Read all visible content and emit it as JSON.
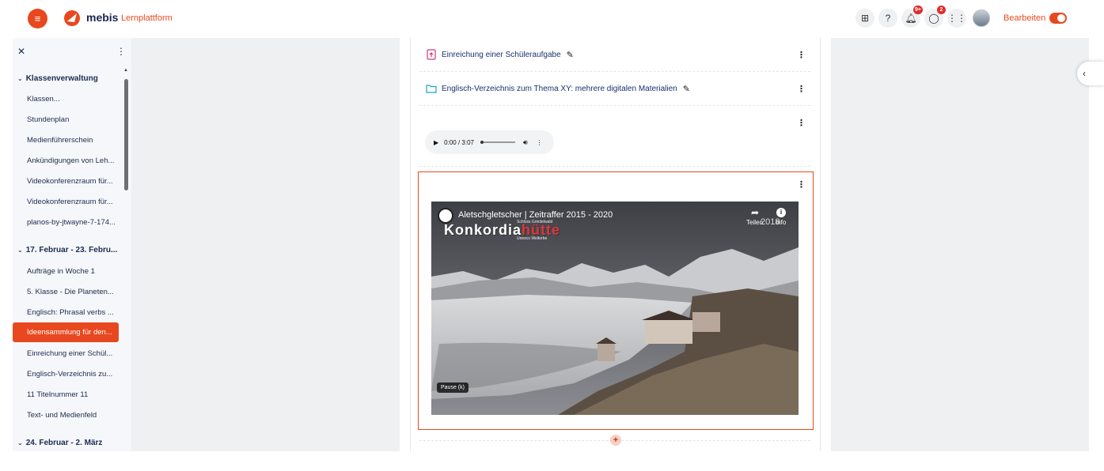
{
  "header": {
    "brand": "mebis",
    "brand_sub": "Lernplattform",
    "icons": [
      "qr-code-icon",
      "help-icon",
      "bell-icon",
      "chat-icon",
      "grid-icon"
    ],
    "notifications_badge": "9+",
    "messages_badge": "2",
    "edit_label": "Bearbeiten",
    "edit_mode": true,
    "accent_color": "#e8481f"
  },
  "drawer": {
    "sections": [
      {
        "title": "Klassenverwaltung",
        "items": [
          "Klassen...",
          "Stundenplan",
          "Medienführerschein",
          "Ankündigungen von Leh...",
          "Videokonferenzraum für...",
          "Videokonferenzraum für...",
          "planos-by-jtwayne-7-174..."
        ]
      },
      {
        "title": "17. Februar - 23. Febru...",
        "items": [
          "Aufträge in Woche 1",
          "5. Klasse - Die Planeten...",
          "Englisch: Phrasal verbs ...",
          "Ideensammlung für den...",
          "Einreichung einer Schül...",
          "Englisch-Verzeichnis zu...",
          "11 Titelnummer 11",
          "Text- und Medienfeld"
        ]
      },
      {
        "title": "24. Februar - 2. März",
        "items": []
      }
    ],
    "active_item": "Ideensammlung für den..."
  },
  "content": {
    "activities": [
      {
        "label": "Einreichung einer Schüleraufgabe",
        "icon": "assignment-icon"
      },
      {
        "label": "Englisch-Verzeichnis zum Thema XY: mehrere digitalen Materialien",
        "icon": "folder-icon"
      }
    ],
    "audio": {
      "time": "0:00 / 3:07"
    },
    "video": {
      "title": "Aletschgletscher | Zeitraffer 2015 - 2020",
      "share_label": "Teilen",
      "info_label": "Info",
      "year_overlay": "2018",
      "brand_overlay_a": "Konkordia",
      "brand_overlay_b": "hütte",
      "brand_small_top": "Schloss Grindelwald",
      "brand_small_bottom": "Unesco Welterbe",
      "pause_label": "Pause (k)"
    }
  }
}
